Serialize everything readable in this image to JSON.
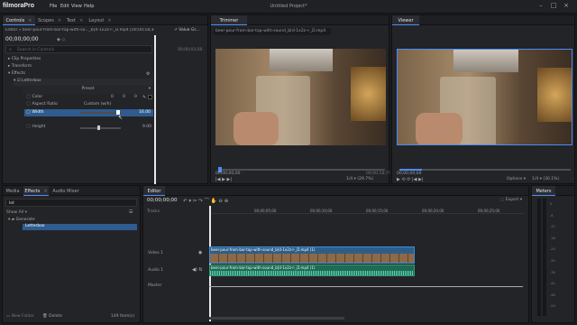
{
  "app": {
    "logo": "filmoraPro",
    "menu": [
      "File",
      "Edit",
      "View",
      "Help"
    ],
    "project_title": "Untitled Project*"
  },
  "left_panel": {
    "tabs": [
      "Controls",
      "Scopes",
      "Text",
      "Layout"
    ],
    "editor_label": "Editor » beer-pour-from-bar-tap-with-so..._b[d-1x2z-r-_D.mp4 [00;00;18;30] [Video]",
    "value_graphs": "Value Gr...",
    "timecode": "00;00;00;00",
    "timecode_end": "00;00;03;00",
    "search_placeholder": "Search in Controls",
    "sections": [
      "Clip Properties",
      "Transform",
      "Effects"
    ],
    "effect_name": "Letterbox",
    "preset_label": "Preset",
    "props": [
      {
        "name": "Color",
        "value": ""
      },
      {
        "name": "Aspect Ratio",
        "value": "Custom (w/h)"
      },
      {
        "name": "Width",
        "value": "16.00"
      },
      {
        "name": "Height",
        "value": "9.00"
      }
    ],
    "color_vals": [
      "0",
      "0",
      "0"
    ]
  },
  "trimmer": {
    "title": "Trimmer",
    "file": "beer-pour-from-bar-tap-with-sound_b[d-1x2z-r-_D.mp4",
    "time_start": "00;00;00;00",
    "time_end": "00;00;18;??",
    "zoom": "1/4",
    "pct": "(29.7%)"
  },
  "viewer": {
    "title": "Viewer",
    "time_start": "00;00;00;00",
    "options": "Options",
    "zoom": "1/4",
    "pct": "(30.1%)"
  },
  "media_panel": {
    "tabs": [
      "Media",
      "Effects",
      "Audio Mixer"
    ],
    "search_value": "let",
    "show_all": "Show All",
    "folder": "Generate",
    "item": "Letterbox",
    "new_folder": "New Folder",
    "delete": "Delete",
    "count": "149 Item(s)"
  },
  "editor_panel": {
    "title": "Editor",
    "timecode": "00;00;00;00",
    "export": "Export",
    "tracks_label": "Tracks",
    "ruler": [
      "00;00;05;00",
      "00;00;10;00",
      "00;00;15;00",
      "00;00;20;00",
      "00;00;25;00"
    ],
    "video_track": "Video 1",
    "audio_track": "Audio 1",
    "master_track": "Master",
    "video_clip": "beer-pour-from-bar-tap-with-sound_b[d-1x2z-r-_D.mp4 (1)",
    "audio_clip": "beer-pour-from-bar-tap-with-sound_b[d-1x2z-r-_D.mp4 (1)"
  },
  "meters_panel": {
    "title": "Meters",
    "scale": [
      "0",
      "-6",
      "-12",
      "-18",
      "-24",
      "-30",
      "-36",
      "-42",
      "-48",
      "-54",
      "-60"
    ]
  },
  "colors": {
    "accent": "#4c8bf5",
    "selection": "#2f5b8f",
    "audio_clip": "#1e6b55",
    "video_clip": "#2d5e8a"
  }
}
